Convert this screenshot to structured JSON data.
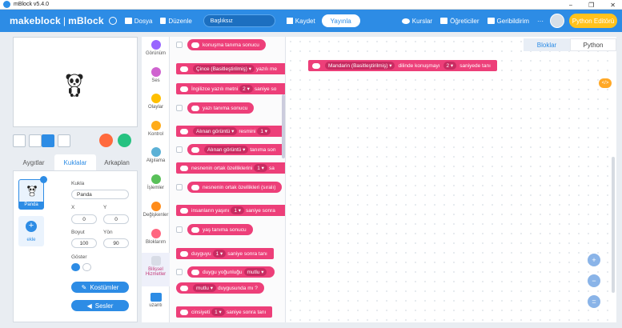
{
  "window": {
    "title": "mBlock v5.4.0",
    "minimize": "−",
    "maximize": "❐",
    "close": "✕"
  },
  "menu": {
    "brand": "makeblock",
    "brand_sep": "|",
    "brand_app": "mBlock",
    "file": "Dosya",
    "edit": "Düzenle",
    "project_name": "Başlıksız",
    "save": "Kaydet",
    "publish": "Yayınla",
    "courses": "Kurslar",
    "tutorials": "Öğreticiler",
    "feedback": "Geribildirim",
    "more": "···",
    "python_editor": "Python Editörü"
  },
  "sprites": {
    "tabs": [
      "Aygıtlar",
      "Kuklalar",
      "Arkaplan"
    ],
    "active_tab": 1,
    "card_name": "Panda",
    "add_label": "ekle",
    "sprite_label": "Kukla",
    "sprite_value": "Panda",
    "x_label": "X",
    "x_value": "0",
    "y_label": "Y",
    "y_value": "0",
    "size_label": "Boyut",
    "size_value": "100",
    "dir_label": "Yön",
    "dir_value": "90",
    "show_label": "Göster",
    "costumes_btn": "Kostümler",
    "sounds_btn": "Sesler"
  },
  "categories": [
    {
      "label": "Görünüm",
      "color": "#9966ff"
    },
    {
      "label": "Ses",
      "color": "#cf63cf"
    },
    {
      "label": "Olaylar",
      "color": "#ffbf00"
    },
    {
      "label": "Kontrol",
      "color": "#ffab19"
    },
    {
      "label": "Algılama",
      "color": "#5cb1d6"
    },
    {
      "label": "İşlemler",
      "color": "#59c059"
    },
    {
      "label": "Değişkenler",
      "color": "#ff8c1a"
    },
    {
      "label": "Bloklarım",
      "color": "#ff6680"
    },
    {
      "label": "Bilişsel Hizmetler",
      "color": "#ed3f79"
    },
    {
      "label": "uzantı",
      "color": "#2d8ce5"
    }
  ],
  "palette": {
    "b1": "konuşma tanıma sonucu",
    "b2_a": "Çince (Basitleştirilmiş) ▾",
    "b2_b": "yazılı me",
    "b3_a": "İngilizce yazılı metni",
    "b3_in": "2 ▾",
    "b3_b": "saniye so",
    "b4": "yazı tanıma sonucu",
    "b5_a": "Alınan görüntü ▾",
    "b5_b": "resmini",
    "b5_in": "1 ▾",
    "b6_a": "Alınan görüntü ▾",
    "b6_b": "tanıma son",
    "b7_a": "nesnenin ortak özelliklerini",
    "b7_in": "1 ▾",
    "b7_b": "sa",
    "b8": "nesnenin ortak özellikleri (sıralı)",
    "b9_a": "insanların yaşını",
    "b9_in": "1 ▾",
    "b9_b": "saniye sonra",
    "b10": "yaş tanıma sonucu",
    "b11_a": "duyguyu",
    "b11_in": "1 ▾",
    "b11_b": "saniye sonra tanı",
    "b12_a": "duygu yoğunluğu",
    "b12_in": "mutlu ▾",
    "b13_in": "mutlu ▾",
    "b13_b": "duygusunda mı ?",
    "b14_a": "cinsiyeti",
    "b14_in": "1 ▾",
    "b14_b": "saniye sonra tanı"
  },
  "workspace": {
    "tab_blocks": "Bloklar",
    "tab_python": "Python",
    "code_badge": "</>",
    "block_lang": "Mandarin (Basitleştirilmiş) ▾",
    "block_mid": "dilinde konuşmayı",
    "block_in": "2 ▾",
    "block_end": "saniyede tanı",
    "zoom_in": "+",
    "zoom_out": "−",
    "zoom_reset": "="
  }
}
